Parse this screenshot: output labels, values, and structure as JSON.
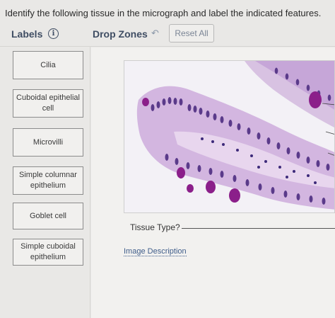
{
  "question": "Identify the following tissue in the micrograph and label the indicated features.",
  "labels_panel": {
    "title": "Labels",
    "info_icon": "i",
    "items": [
      "Cilia",
      "Cuboidal epithelial cell",
      "Microvilli",
      "Simple columnar epithelium",
      "Goblet cell",
      "Simple cuboidal epithelium"
    ]
  },
  "dropzones": {
    "title": "Drop Zones",
    "undo_icon": "↶",
    "reset_label": "Reset All"
  },
  "tissue_type": {
    "label": "Tissue Type?"
  },
  "image_description_link": "Image Description",
  "colors": {
    "heading": "#3f4d63",
    "link": "#3f5d8a",
    "tissue_pink": "#c9a4d6",
    "nucleus_purple": "#5a3a8a",
    "goblet_magenta": "#8b1f8a"
  }
}
